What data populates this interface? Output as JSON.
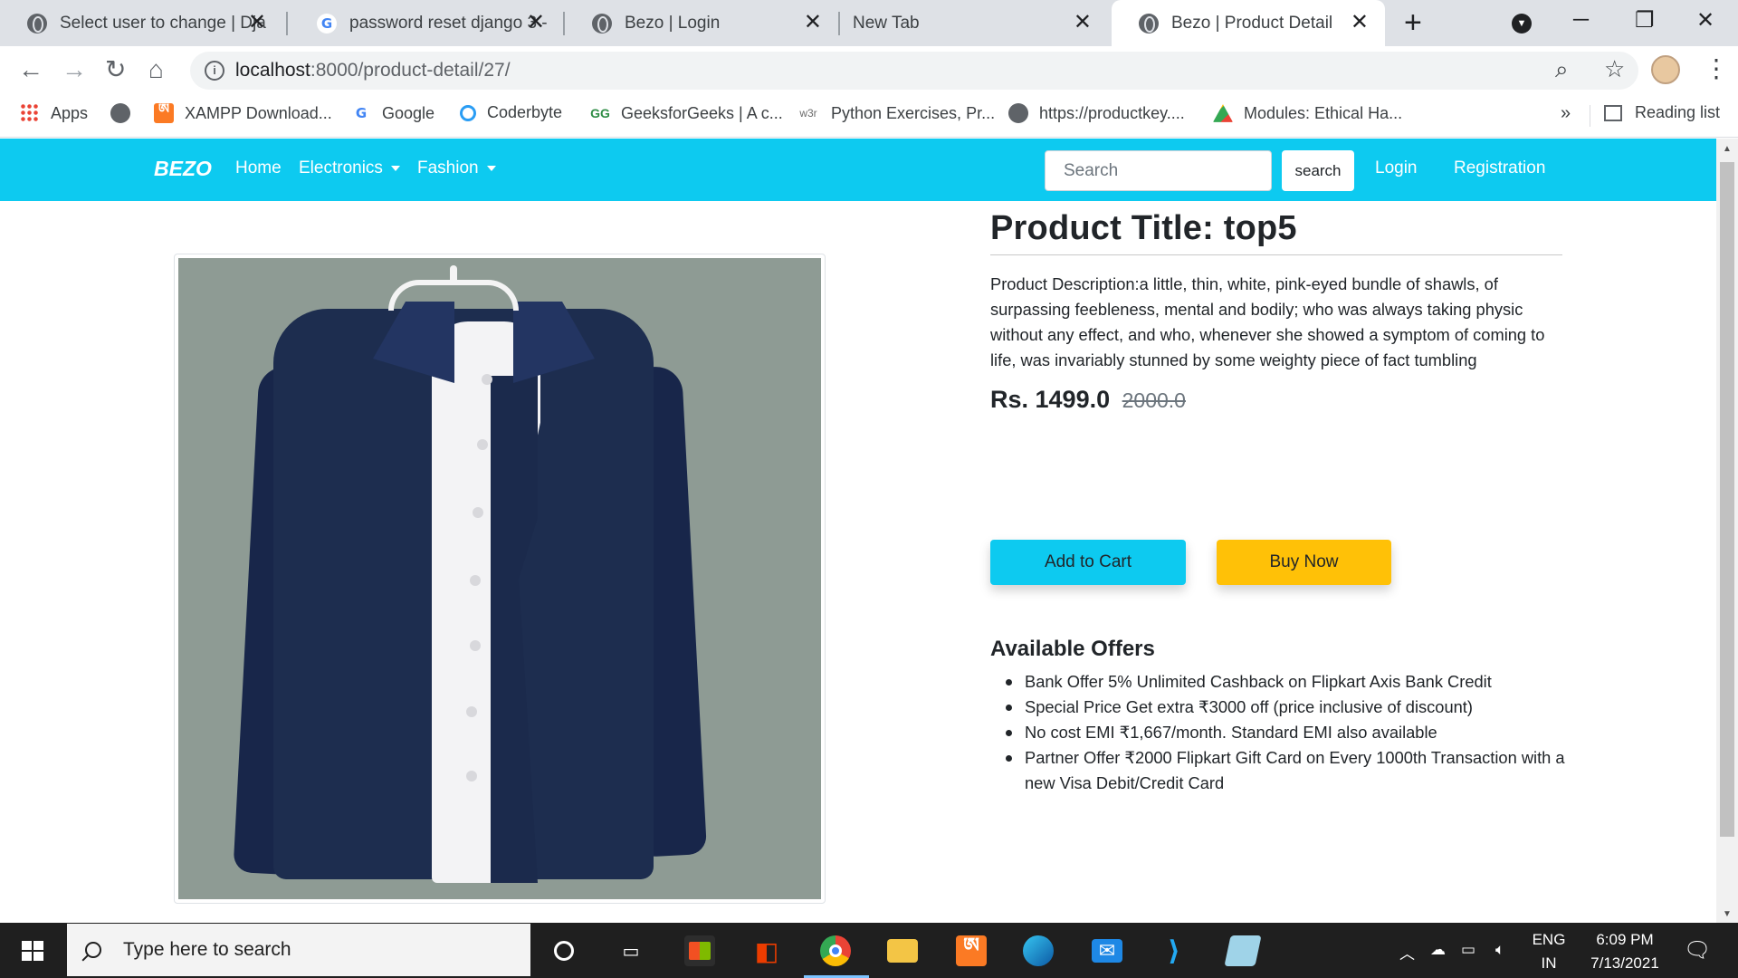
{
  "browser": {
    "tabs": [
      {
        "title": "Select user to change | Dja",
        "icon": "globe-icon",
        "active": false
      },
      {
        "title": "password reset django 3 -",
        "icon": "google-icon",
        "active": false
      },
      {
        "title": "Bezo | Login",
        "icon": "globe-icon",
        "active": false
      },
      {
        "title": "New Tab",
        "icon": "",
        "active": false
      },
      {
        "title": "Bezo | Product Detail",
        "icon": "globe-icon",
        "active": true
      }
    ],
    "tab_close": "✕",
    "new_tab": "+",
    "window_controls": {
      "minimize": "─",
      "restore": "❐",
      "close": "✕"
    },
    "nav": {
      "back": "←",
      "forward": "→",
      "reload": "↻",
      "home": "⌂"
    },
    "url_host": "localhost",
    "url_path": ":8000/product-detail/27/",
    "bookmarks": [
      {
        "label": "Apps",
        "icon": "apps-grid-icon"
      },
      {
        "label": "",
        "icon": "globe-icon"
      },
      {
        "label": "XAMPP Download...",
        "icon": "xampp-icon"
      },
      {
        "label": "Google",
        "icon": "google-icon"
      },
      {
        "label": "Coderbyte",
        "icon": "coderbyte-icon"
      },
      {
        "label": "GeeksforGeeks | A c...",
        "icon": "gfg-icon"
      },
      {
        "label": "Python Exercises, Pr...",
        "icon": "w3schools-icon"
      },
      {
        "label": "https://productkey....",
        "icon": "globe-icon"
      },
      {
        "label": "Modules: Ethical Ha...",
        "icon": "google-drive-icon"
      }
    ],
    "bookmarks_more": "»",
    "reading_list": "Reading list"
  },
  "site": {
    "brand": "BEZO",
    "nav": {
      "home": "Home",
      "electronics": "Electronics",
      "fashion": "Fashion",
      "login": "Login",
      "registration": "Registration"
    },
    "search_placeholder": "Search",
    "search_button": "search",
    "accent_color": "#0dcaf0",
    "buy_color": "#ffc107"
  },
  "product": {
    "title": "Product Title: top5",
    "description": "Product Description:a little, thin, white, pink-eyed bundle of shawls, of surpassing feebleness, mental and bodily; who was always taking physic without any effect, and who, whenever she showed a symptom of coming to life, was invariably stunned by some weighty piece of fact tumbling",
    "price": "Rs. 1499.0",
    "old_price": "2000.0",
    "add_to_cart": "Add to Cart",
    "buy_now": "Buy Now",
    "offers_title": "Available Offers",
    "offers": [
      "Bank Offer 5% Unlimited Cashback on Flipkart Axis Bank Credit",
      "Special Price Get extra ₹3000 off (price inclusive of discount)",
      "No cost EMI ₹1,667/month. Standard EMI also available",
      "Partner Offer ₹2000 Flipkart Gift Card on Every 1000th Transaction with a new Visa Debit/Credit Card"
    ],
    "image_subject": "navy-blue-shirt-on-hanger"
  },
  "taskbar": {
    "search_placeholder": "Type here to search",
    "apps": [
      "cortana-icon",
      "task-view-icon",
      "store-icon",
      "office-icon",
      "chrome-icon",
      "file-explorer-icon",
      "xampp-icon",
      "edge-icon",
      "mail-icon",
      "vscode-icon",
      "notepad-icon"
    ],
    "language": "ENG",
    "region": "IN",
    "time": "6:09 PM",
    "date": "7/13/2021"
  }
}
